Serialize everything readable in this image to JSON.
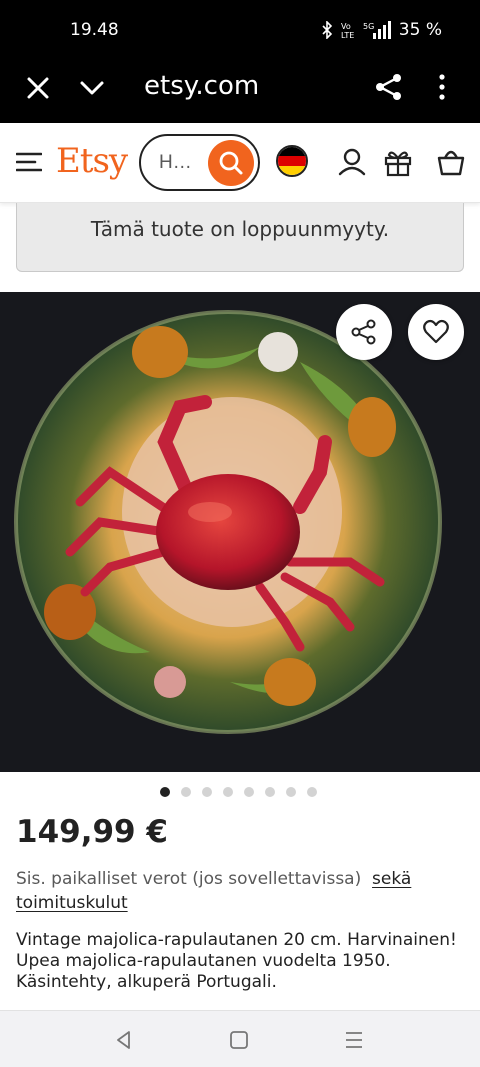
{
  "status_bar": {
    "time": "19.48",
    "battery": "35 %"
  },
  "browser": {
    "url": "etsy.com"
  },
  "header": {
    "logo": "Etsy",
    "search_placeholder": "H…"
  },
  "banner": {
    "sold_out_text": "Tämä tuote on loppuunmyyty."
  },
  "gallery": {
    "image_count": 8,
    "active_index": 0
  },
  "product": {
    "price": "149,99 €",
    "tax_text": "Sis. paikalliset verot (jos sovellettavissa)",
    "shipping_link": "sekä toimituskulut",
    "description_lines": [
      "Vintage majolica-rapulautanen 20 cm. Harvinainen!",
      "Upea majolica-rapulautanen vuodelta 1950.",
      "Käsintehty, alkuperä Portugali."
    ]
  },
  "colors": {
    "accent": "#f1641e",
    "text": "#222222",
    "muted": "#595959"
  }
}
